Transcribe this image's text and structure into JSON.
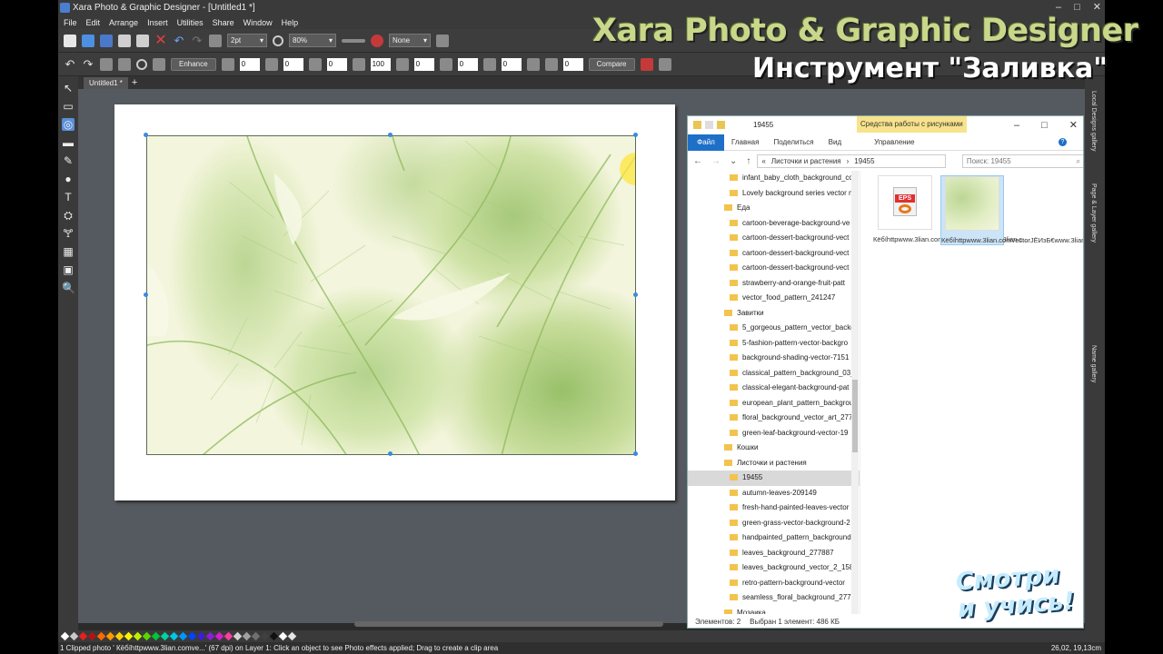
{
  "app": {
    "title": "Xara Photo & Graphic Designer - [Untitled1 *]",
    "window_controls": [
      "–",
      "□",
      "✕"
    ]
  },
  "menu": [
    "File",
    "Edit",
    "Arrange",
    "Insert",
    "Utilities",
    "Share",
    "Window",
    "Help"
  ],
  "toolbar": {
    "line_width": "2pt",
    "zoom": "80%",
    "fill_none": "None",
    "enhance_label": "Enhance",
    "compare_label": "Compare",
    "fields": [
      "0",
      "0",
      "0",
      "100",
      "0",
      "0",
      "0",
      "0"
    ]
  },
  "tools": [
    "↖",
    "▭",
    "◎",
    "▬",
    "✎",
    "●",
    "T",
    "⛭",
    "🝖",
    "▦",
    "▣",
    "🔍"
  ],
  "document": {
    "tab_label": "Untitled1 *",
    "add_tab": "+"
  },
  "explorer": {
    "folder_name": "19455",
    "context_tab": "Средства работы с рисунками",
    "ribbon": {
      "file": "Файл",
      "tabs": [
        "Главная",
        "Поделиться",
        "Вид"
      ],
      "manage": "Управление"
    },
    "address": {
      "prefix": "«",
      "parent": "Листочки и растения",
      "sep": "›",
      "current": "19455"
    },
    "search_placeholder": "Поиск: 19455",
    "tree": [
      {
        "label": "infant_baby_cloth_background_co",
        "lvl": 2
      },
      {
        "label": "Lovely background series vector m",
        "lvl": 2
      },
      {
        "label": "Еда",
        "lvl": 1
      },
      {
        "label": "cartoon-beverage-background-ve",
        "lvl": 2
      },
      {
        "label": "cartoon-dessert-background-vect",
        "lvl": 2
      },
      {
        "label": "cartoon-dessert-background-vect",
        "lvl": 2
      },
      {
        "label": "cartoon-dessert-background-vect",
        "lvl": 2
      },
      {
        "label": "strawberry-and-orange-fruit-patt",
        "lvl": 2
      },
      {
        "label": "vector_food_pattern_241247",
        "lvl": 2
      },
      {
        "label": "Завитки",
        "lvl": 1
      },
      {
        "label": "5_gorgeous_pattern_vector_backg",
        "lvl": 2
      },
      {
        "label": "5-fashion-pattern-vector-backgro",
        "lvl": 2
      },
      {
        "label": "background-shading-vector-7151",
        "lvl": 2
      },
      {
        "label": "classical_pattern_background_03_",
        "lvl": 2
      },
      {
        "label": "classical-elegant-background-pat",
        "lvl": 2
      },
      {
        "label": "european_plant_pattern_backgrou",
        "lvl": 2
      },
      {
        "label": "floral_background_vector_art_277",
        "lvl": 2
      },
      {
        "label": "green-leaf-background-vector-19",
        "lvl": 2
      },
      {
        "label": "Кошки",
        "lvl": 1
      },
      {
        "label": "Листочки и растения",
        "lvl": 1
      },
      {
        "label": "19455",
        "lvl": 2,
        "selected": true
      },
      {
        "label": "autumn-leaves-209149",
        "lvl": 2
      },
      {
        "label": "fresh-hand-painted-leaves-vector",
        "lvl": 2
      },
      {
        "label": "green-grass-vector-background-2",
        "lvl": 2
      },
      {
        "label": "handpainted_pattern_background",
        "lvl": 2
      },
      {
        "label": "leaves_background_277887",
        "lvl": 2
      },
      {
        "label": "leaves_background_vector_2_1582",
        "lvl": 2
      },
      {
        "label": "retro-pattern-background-vector",
        "lvl": 2
      },
      {
        "label": "seamless_floral_background_2777",
        "lvl": 2
      },
      {
        "label": "Мозаика",
        "lvl": 1
      }
    ],
    "files": [
      {
        "name": "Кёбíhttpwww.3lian.comvectorЈЁИзБ€www.3lian.c...",
        "badge": "EPS"
      },
      {
        "name": "Кёбíhttpwww.3lian.comvectorЈЁИзБ€www.3lian.c..."
      }
    ],
    "status": {
      "count": "Элементов: 2",
      "selected": "Выбран 1 элемент: 486 КБ"
    }
  },
  "right_panel": [
    "Local Designs gallery",
    "Page & Layer gallery",
    "Name gallery"
  ],
  "overlay": {
    "brand_title": "Xara Photo & Graphic Designer",
    "brand_subtitle": "Инструмент \"Заливка\"",
    "stamp_line1": "Смотри",
    "stamp_line2": "и учись!"
  },
  "palette_colors": [
    "#ffffff",
    "#c8c8c8",
    "#e81f1f",
    "#b01515",
    "#ff6a00",
    "#ff9b00",
    "#ffd000",
    "#fff200",
    "#bcef00",
    "#5ad400",
    "#00c43a",
    "#00d2a0",
    "#00c8e6",
    "#0096ff",
    "#0044ff",
    "#3a1fd8",
    "#8a1fd8",
    "#d21fd2",
    "#ff3ca0",
    "#d2d2d2",
    "#a0a0a0",
    "#707070",
    "#404040",
    "#111111",
    "#ffffff",
    "#e6e6e6"
  ],
  "statusbar": {
    "message": "1 Clipped photo ' Кёбíhttpwww.3lian.comve...' (67 dpi) on Layer 1: Click an object to see Photo effects applied; Drag to create a clip area",
    "coords": "26,02, 19,13cm"
  }
}
